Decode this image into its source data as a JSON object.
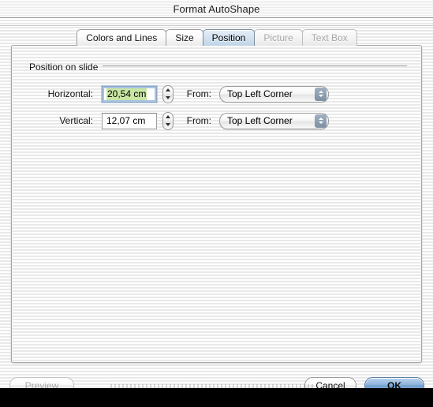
{
  "window": {
    "title": "Format AutoShape"
  },
  "tabs": [
    {
      "label": "Colors and Lines",
      "state": "normal"
    },
    {
      "label": "Size",
      "state": "normal"
    },
    {
      "label": "Position",
      "state": "selected"
    },
    {
      "label": "Picture",
      "state": "disabled"
    },
    {
      "label": "Text Box",
      "state": "disabled"
    }
  ],
  "group": {
    "label": "Position on slide"
  },
  "fields": {
    "horizontal": {
      "label": "Horizontal:",
      "value": "20,54 cm",
      "selected": true,
      "from_label": "From:",
      "from_value": "Top Left Corner"
    },
    "vertical": {
      "label": "Vertical:",
      "value": "12,07 cm",
      "selected": false,
      "from_label": "From:",
      "from_value": "Top Left Corner"
    }
  },
  "buttons": {
    "preview": "Preview",
    "cancel": "Cancel",
    "ok": "OK"
  },
  "colors": {
    "selection_green": "#c9e6a3",
    "tab_selected_blue": "#d2e1f0",
    "default_button_blue": "#8fb5dd",
    "popup_arrow_box": "#8e9fb1"
  }
}
